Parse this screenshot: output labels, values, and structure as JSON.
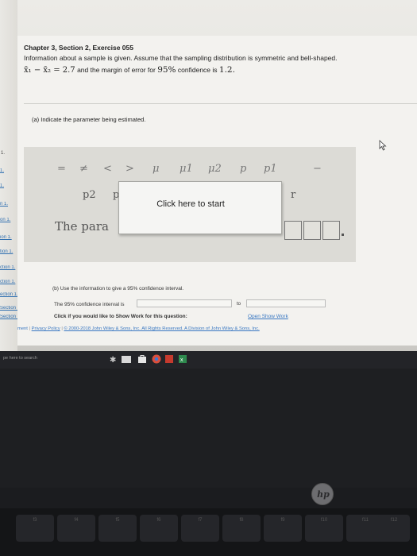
{
  "exercise": {
    "chapter_title": "Chapter 3, Section 2, Exercise 055",
    "instructions": "Information about a sample is given. Assume that the sampling distribution is symmetric and bell-shaped.",
    "given_expr": "x̄₁ − x̄₂ = 2.7",
    "given_text_1": "and the margin of error for",
    "given_confidence": "95%",
    "given_text_2": "confidence is",
    "given_margin": "1.2."
  },
  "part_a": {
    "label": "(a) Indicate the parameter being estimated.",
    "symbols": [
      "=",
      "≠",
      "<",
      ">",
      "μ",
      "μ1",
      "μ2",
      "p",
      "p1",
      "−"
    ],
    "symbols_row2": [
      "p2",
      "p",
      "r"
    ],
    "parameter_text": "The para",
    "overlay_text": "Click here to start"
  },
  "part_b": {
    "label": "(b) Use the information to give a 95% confidence interval.",
    "interval_label": "The 95% confidence interval is",
    "to_text": "to",
    "show_work_text": "Click if you would like to Show Work for this question:",
    "show_work_link": "Open Show Work"
  },
  "footer": {
    "links": [
      "ment",
      "Privacy Policy",
      "© 2000-2018 John Wiley & Sons, Inc. All Rights Reserved. A Division of John Wiley & Sons, Inc."
    ]
  },
  "sidebar": {
    "items": [
      "1.",
      "1.",
      "n 1.",
      "on 1.",
      "ion 1.",
      "tion 1.",
      "ction 1.",
      "ction 1.",
      "ection 1.",
      "Section 1.",
      "Section 1."
    ]
  },
  "taskbar": {
    "search_text": "pe here to search"
  },
  "laptop": {
    "logo": "hp",
    "keys": [
      "f3",
      "f4",
      "f5",
      "f6",
      "f7",
      "f8",
      "f9",
      "f10",
      "f11",
      "f12"
    ]
  },
  "colors": {
    "link": "#3a78c2",
    "panel": "#dcdbd6"
  }
}
